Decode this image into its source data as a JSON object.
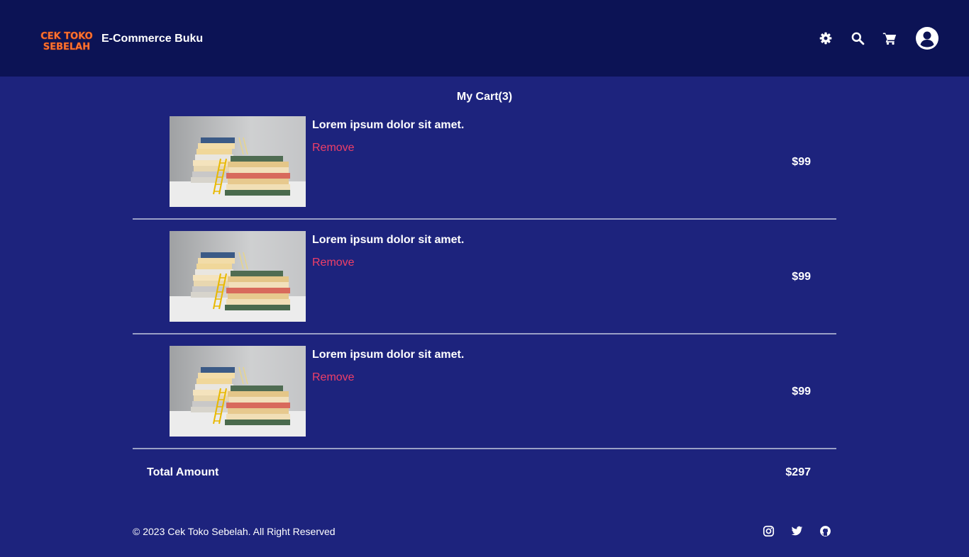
{
  "header": {
    "logo_text_line1": "CEK TOKO",
    "logo_text_line2": "SEBELAH",
    "brand": "E-Commerce Buku",
    "icons": [
      "gear-icon",
      "search-icon",
      "cart-icon",
      "user-avatar-icon"
    ]
  },
  "cart": {
    "title": "My Cart(3)",
    "items": [
      {
        "title": "Lorem ipsum dolor sit amet.",
        "remove_label": "Remove",
        "price": "$99"
      },
      {
        "title": "Lorem ipsum dolor sit amet.",
        "remove_label": "Remove",
        "price": "$99"
      },
      {
        "title": "Lorem ipsum dolor sit amet.",
        "remove_label": "Remove",
        "price": "$99"
      }
    ],
    "total_label": "Total Amount",
    "total_value": "$297"
  },
  "footer": {
    "copyright": "© 2023 Cek Toko Sebelah. All Right Reserved",
    "social_icons": [
      "instagram-icon",
      "twitter-icon",
      "github-icon"
    ]
  },
  "colors": {
    "background": "#1d237d",
    "header": "#0c1355",
    "remove": "#ef3f68",
    "logo": "#ff7a3d",
    "divider": "#9aa0c6"
  }
}
